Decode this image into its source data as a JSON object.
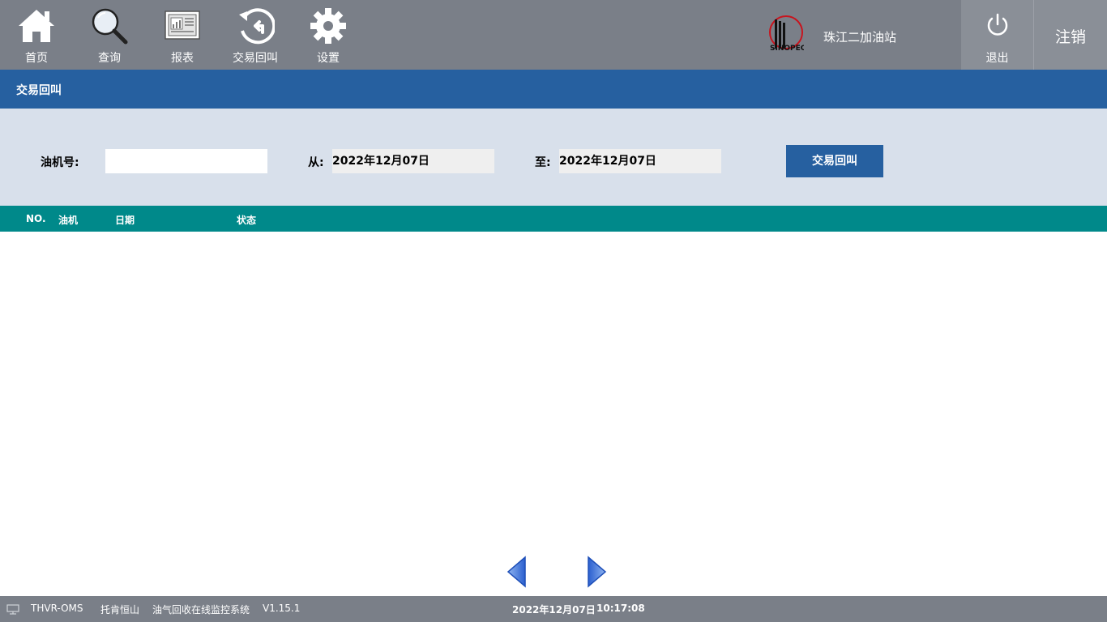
{
  "nav": {
    "items": [
      {
        "label": "首页",
        "icon": "home-icon"
      },
      {
        "label": "查询",
        "icon": "search-icon"
      },
      {
        "label": "报表",
        "icon": "report-icon"
      },
      {
        "label": "交易回叫",
        "icon": "callback-icon"
      },
      {
        "label": "设置",
        "icon": "gear-icon"
      }
    ],
    "station_name": "珠江二加油站",
    "exit_label": "退出",
    "logout_label": "注销"
  },
  "title": "交易回叫",
  "filter": {
    "pump_label": "油机号:",
    "pump_value": "",
    "from_label": "从:",
    "from_date": "2022年12月07日",
    "to_label": "至:",
    "to_date": "2022年12月07日",
    "button_label": "交易回叫"
  },
  "table": {
    "columns": [
      "NO.",
      "油机",
      "日期",
      "状态"
    ],
    "rows": []
  },
  "status_bar": {
    "app_code": "THVR-OMS",
    "company": "托肯恒山",
    "system_name": "油气回收在线监控系统",
    "version": "V1.15.1",
    "date": "2022年12月07日",
    "time": "10:17:08"
  },
  "colors": {
    "topbar": "#7a7f88",
    "title_bar": "#2660a0",
    "filter_bg": "#d8e0eb",
    "table_header": "#00898a"
  }
}
